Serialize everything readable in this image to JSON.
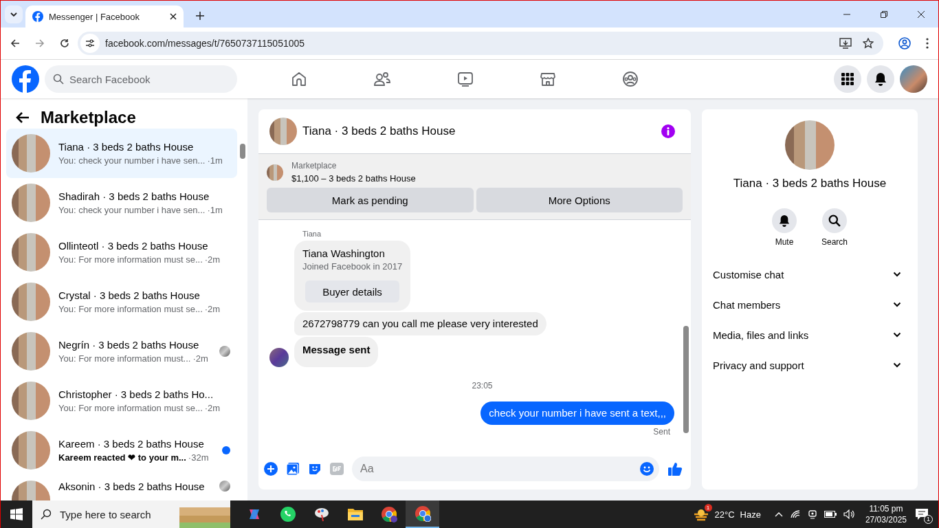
{
  "browser": {
    "tab_title": "Messenger | Facebook",
    "url": "facebook.com/messages/t/7650737115051005"
  },
  "facebook": {
    "search_placeholder": "Search Facebook"
  },
  "sidebar": {
    "title": "Marketplace",
    "conversations": [
      {
        "name": "Tiana · 3 beds 2 baths House",
        "preview": "You: check your number i have sen...",
        "time": "·1m",
        "selected": true,
        "unread": false,
        "seen": false
      },
      {
        "name": "Shadirah · 3 beds 2 baths House",
        "preview": "You: check your number i have sen...",
        "time": "·1m",
        "selected": false,
        "unread": false,
        "seen": false
      },
      {
        "name": "Ollinteotl · 3 beds 2 baths House",
        "preview": "You: For more information must se...",
        "time": "·2m",
        "selected": false,
        "unread": false,
        "seen": false
      },
      {
        "name": "Crystal · 3 beds 2 baths House",
        "preview": "You: For more information must se...",
        "time": "·2m",
        "selected": false,
        "unread": false,
        "seen": false
      },
      {
        "name": "Negrín · 3 beds 2 baths House",
        "preview": "You: For more information must...",
        "time": "·2m",
        "selected": false,
        "unread": false,
        "seen": true
      },
      {
        "name": "Christopher · 3 beds 2 baths Ho...",
        "preview": "You: For more information must se...",
        "time": "·2m",
        "selected": false,
        "unread": false,
        "seen": false
      },
      {
        "name": "Kareem · 3 beds 2 baths House",
        "preview": "Kareem reacted ❤ to your m...",
        "time": "·32m",
        "selected": false,
        "unread": true,
        "seen": false
      },
      {
        "name": "Aksonin · 3 beds 2 baths House",
        "selected": false,
        "unread": false,
        "seen": true
      }
    ]
  },
  "chat": {
    "title": "Tiana · 3 beds 2 baths House",
    "listing": {
      "label": "Marketplace",
      "text": "$1,100 – 3 beds 2 baths House",
      "buttons": [
        "Mark as pending",
        "More Options"
      ]
    },
    "thread": [
      {
        "kind": "sender",
        "text": "Tiana"
      },
      {
        "kind": "card",
        "name": "Tiana Washington",
        "subtitle": "Joined Facebook in 2017",
        "button": "Buyer details"
      },
      {
        "kind": "incoming",
        "text": "2672798779 can you call me please very interested",
        "avatar": false,
        "bold": false
      },
      {
        "kind": "incoming",
        "text": "Message sent",
        "avatar": true,
        "bold": true
      },
      {
        "kind": "timestamp",
        "text": "23:05"
      },
      {
        "kind": "outgoing",
        "text": "check your number i have sent a text,,,"
      },
      {
        "kind": "status",
        "text": "Sent"
      }
    ],
    "composer_placeholder": "Aa"
  },
  "details": {
    "name": "Tiana · 3 beds 2 baths House",
    "actions": [
      {
        "kind": "mute",
        "label": "Mute"
      },
      {
        "kind": "search",
        "label": "Search"
      }
    ],
    "sections": [
      {
        "label": "Customise chat",
        "expanded": false
      },
      {
        "label": "Chat members",
        "expanded": false
      },
      {
        "label": "Media, files and links",
        "expanded": false
      },
      {
        "label": "Privacy and support",
        "expanded": false
      }
    ]
  },
  "taskbar": {
    "search_placeholder": "Type here to search",
    "weather_badge": "1",
    "temperature": "22°C",
    "condition": "Haze",
    "time": "11:05 pm",
    "date": "27/03/2025",
    "notification_count": "1"
  }
}
